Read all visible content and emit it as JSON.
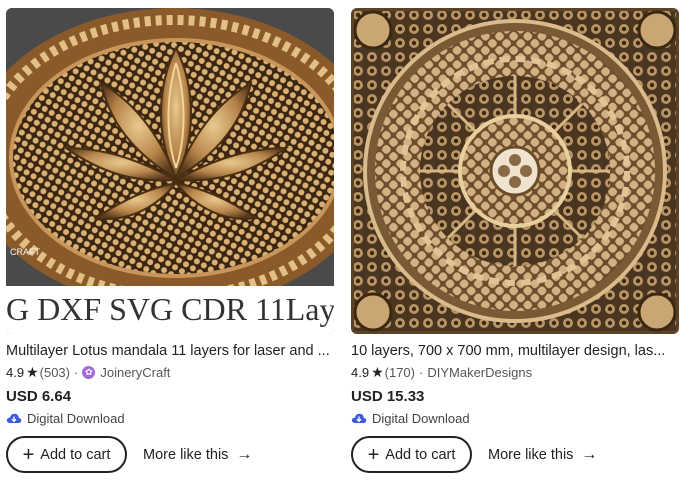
{
  "products": [
    {
      "image_caption": "G DXF SVG CDR 11Lay",
      "image_brand": "CRAFT",
      "title": "Multilayer Lotus mandala 11 layers for laser and ...",
      "rating": "4.9",
      "reviews": "(503)",
      "separator": "·",
      "shop": "JoineryCraft",
      "price": "USD 6.64",
      "download": "Digital Download",
      "add_to_cart": "Add to cart",
      "more_like_this": "More like this"
    },
    {
      "title": "10 layers, 700 x 700 mm, multilayer design, las...",
      "rating": "4.9",
      "reviews": "(170)",
      "separator": "·",
      "shop": "DIYMakerDesigns",
      "price": "USD 15.33",
      "download": "Digital Download",
      "add_to_cart": "Add to cart",
      "more_like_this": "More like this"
    }
  ],
  "icons": {
    "star": "star-icon",
    "shop_badge": "star-seller-badge-icon",
    "download": "cloud-download-icon",
    "plus": "plus-icon",
    "arrow": "arrow-right-icon"
  },
  "colors": {
    "badge": "#a06cd5",
    "download_icon": "#3b5bdb",
    "wood_light": "#d8b57c",
    "wood_dark": "#5a3a1c"
  }
}
